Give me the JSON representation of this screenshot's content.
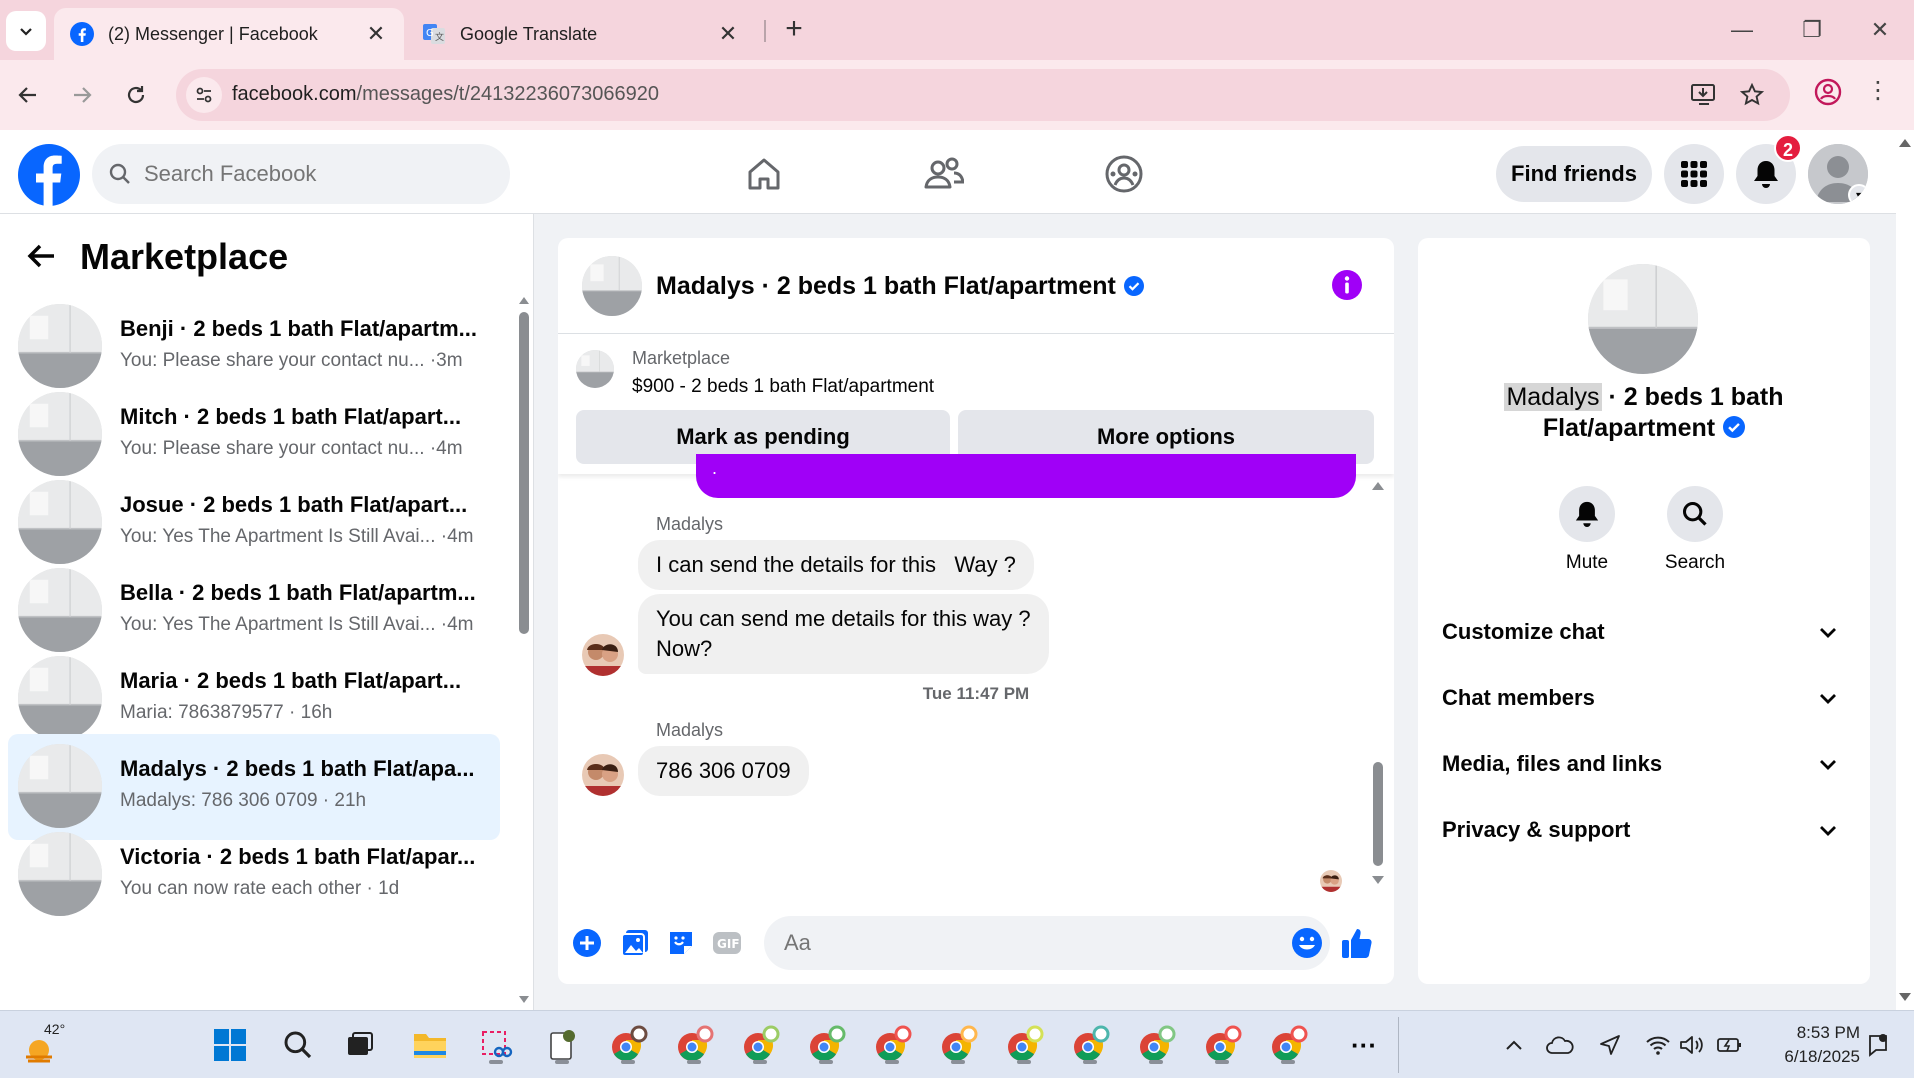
{
  "browser": {
    "tabs": [
      {
        "title": "(2) Messenger | Facebook",
        "active": true,
        "icon": "facebook-icon"
      },
      {
        "title": "Google Translate",
        "active": false,
        "icon": "google-translate-icon"
      }
    ],
    "url_domain": "facebook.com",
    "url_path": "/messages/t/24132236073066920"
  },
  "header": {
    "search_placeholder": "Search Facebook",
    "find_friends": "Find friends",
    "notification_count": "2"
  },
  "sidebar": {
    "title": "Marketplace",
    "conversations": [
      {
        "name": "Benji · 2 beds 1 bath Flat/apartm...",
        "preview": "You: Please share your contact nu... ·3m",
        "selected": false
      },
      {
        "name": "Mitch · 2 beds 1 bath Flat/apart...",
        "preview": "You: Please share your contact nu... ·4m",
        "selected": false
      },
      {
        "name": "Josue · 2 beds 1 bath Flat/apart...",
        "preview": "You: Yes The Apartment Is Still Avai... ·4m",
        "selected": false
      },
      {
        "name": "Bella · 2 beds 1 bath Flat/apartm...",
        "preview": "You: Yes The Apartment Is Still Avai... ·4m",
        "selected": false
      },
      {
        "name": "Maria · 2 beds 1 bath Flat/apart...",
        "preview": "Maria: 7863879577 · 16h",
        "selected": false
      },
      {
        "name": "Madalys · 2 beds 1 bath Flat/apa...",
        "preview": "Madalys: 786 306 0709 · 21h",
        "selected": true
      },
      {
        "name": "Victoria · 2 beds 1 bath Flat/apar...",
        "preview": "You can now rate each other · 1d",
        "selected": false
      }
    ]
  },
  "chat": {
    "title": "Madalys · 2 beds 1 bath Flat/apartment",
    "listing_source": "Marketplace",
    "listing_price": "$900 - 2 beds 1 bath Flat/apartment",
    "mark_pending": "Mark as pending",
    "more_options": "More options",
    "outgoing_fragment": ".",
    "sender1": "Madalys",
    "msg1": "I can send the details for this   Way ?",
    "msg2_line1": "You can send me details for this way ?",
    "msg2_line2": "Now?",
    "timestamp": "Tue 11:47 PM",
    "sender2": "Madalys",
    "msg3": "786 306 0709",
    "composer_placeholder": "Aa"
  },
  "details": {
    "name_highlight": "Madalys",
    "name_rest": " · 2 beds 1 bath",
    "name_line2": "Flat/apartment",
    "mute": "Mute",
    "search": "Search",
    "sections": [
      "Customize chat",
      "Chat members",
      "Media, files and links",
      "Privacy & support"
    ]
  },
  "taskbar": {
    "temperature": "42°",
    "time": "8:53 PM",
    "date": "6/18/2025"
  },
  "colors": {
    "facebook_blue": "#0866ff",
    "messenger_purple": "#a000f7",
    "selected_row": "#e7f3ff",
    "notification_red": "#e41e3f"
  }
}
